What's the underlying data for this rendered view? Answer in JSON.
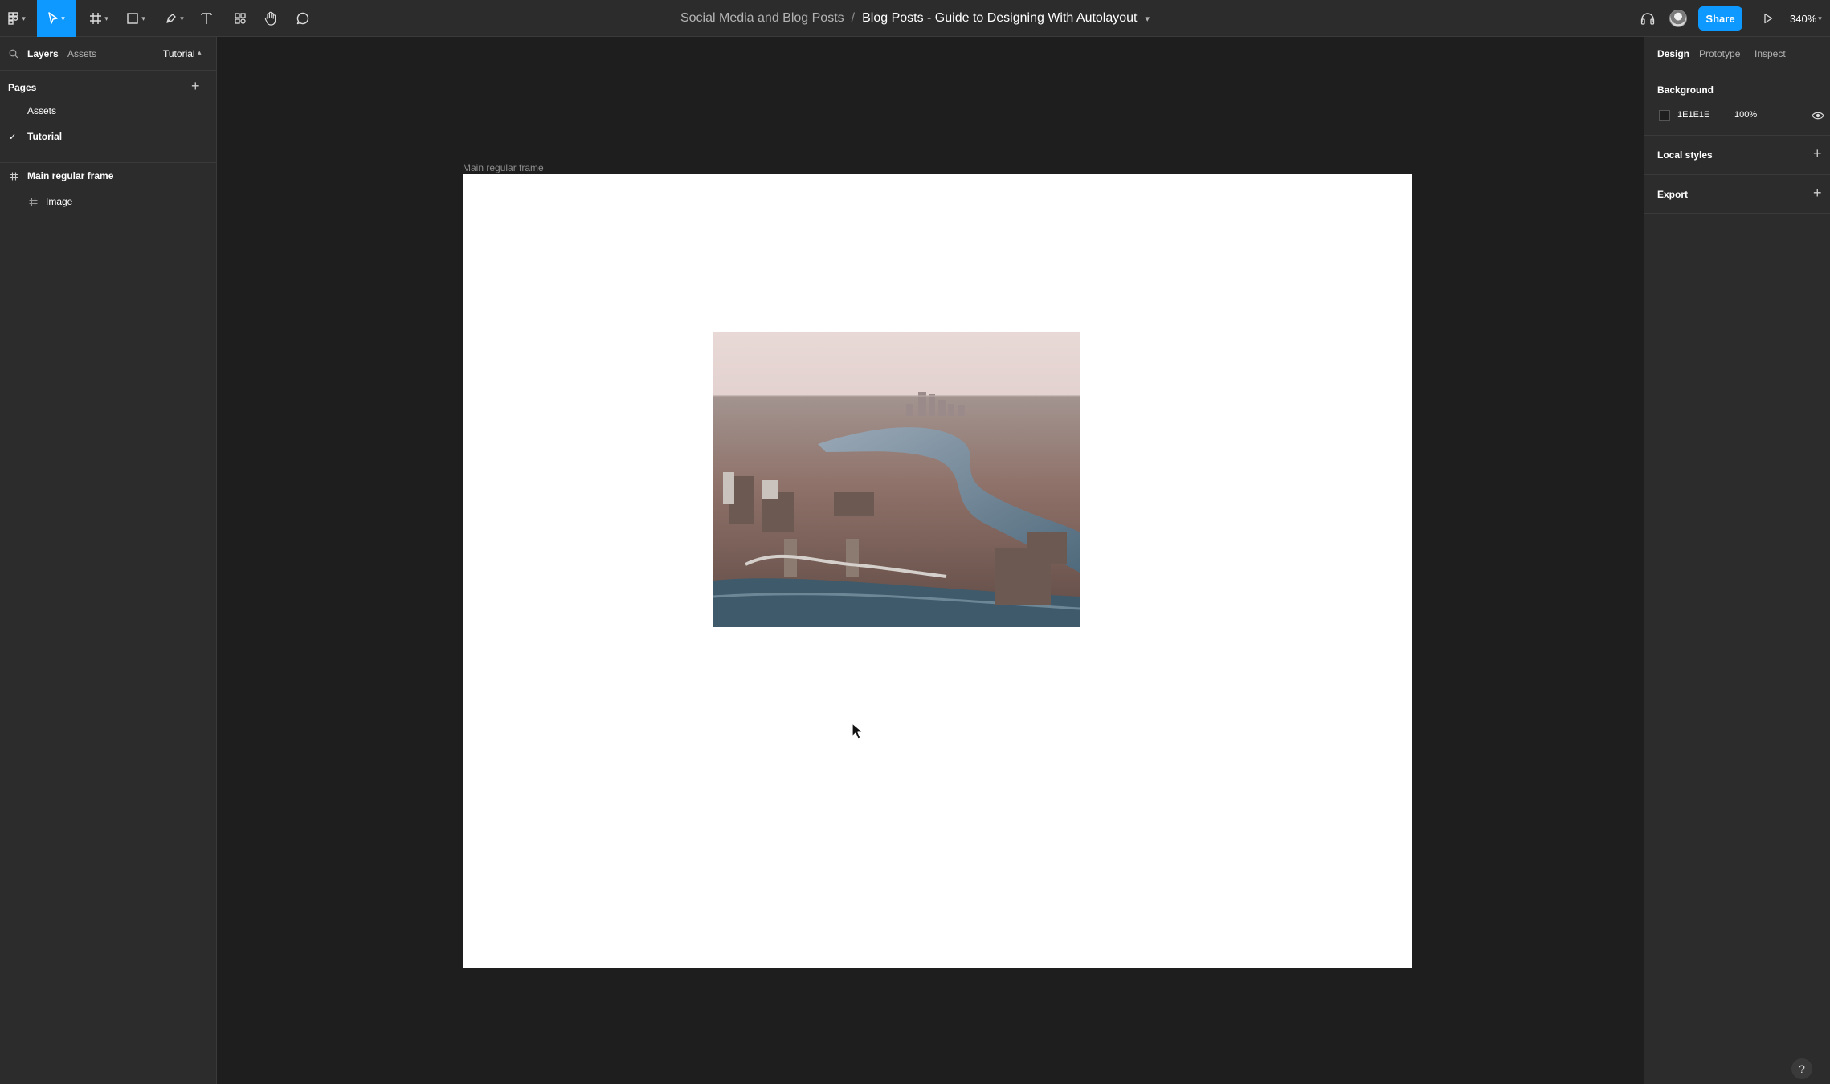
{
  "toolbar": {
    "tools": [
      {
        "name": "main-menu",
        "icon": "figma-logo-icon"
      },
      {
        "name": "move-tool",
        "icon": "cursor-arrow-icon",
        "active": true
      },
      {
        "name": "frame-tool",
        "icon": "hash-frame-icon"
      },
      {
        "name": "shape-tool",
        "icon": "rectangle-icon"
      },
      {
        "name": "pen-tool",
        "icon": "pen-icon"
      },
      {
        "name": "text-tool",
        "icon": "text-T-icon"
      },
      {
        "name": "resources-tool",
        "icon": "components-icon"
      },
      {
        "name": "hand-tool",
        "icon": "hand-icon"
      },
      {
        "name": "comment-tool",
        "icon": "speech-bubble-icon"
      }
    ],
    "accent_color": "#0d99ff"
  },
  "breadcrumb": {
    "project": "Social Media and Blog Posts",
    "separator": "/",
    "file": "Blog Posts - Guide to Designing With Autolayout"
  },
  "right_header": {
    "share_label": "Share",
    "zoom": "340%"
  },
  "left_panel": {
    "tabs": {
      "layers": "Layers",
      "assets": "Assets",
      "page_dropdown": "Tutorial"
    },
    "pages_title": "Pages",
    "pages": [
      {
        "label": "Assets",
        "current": false
      },
      {
        "label": "Tutorial",
        "current": true
      }
    ],
    "layers": [
      {
        "label": "Main regular frame",
        "depth": 0,
        "icon": "hash-frame-icon"
      },
      {
        "label": "Image",
        "depth": 1,
        "icon": "hash-frame-icon"
      }
    ]
  },
  "right_panel": {
    "tabs": {
      "design": "Design",
      "prototype": "Prototype",
      "inspect": "Inspect"
    },
    "background": {
      "title": "Background",
      "hex": "1E1E1E",
      "opacity": "100%",
      "swatch_color": "#1e1e1e"
    },
    "local_styles_title": "Local styles",
    "export_title": "Export"
  },
  "canvas": {
    "frame_label": "Main regular frame",
    "frame_color": "#ffffff",
    "image_icon": "aerial-city-river-photo"
  },
  "help_label": "?"
}
